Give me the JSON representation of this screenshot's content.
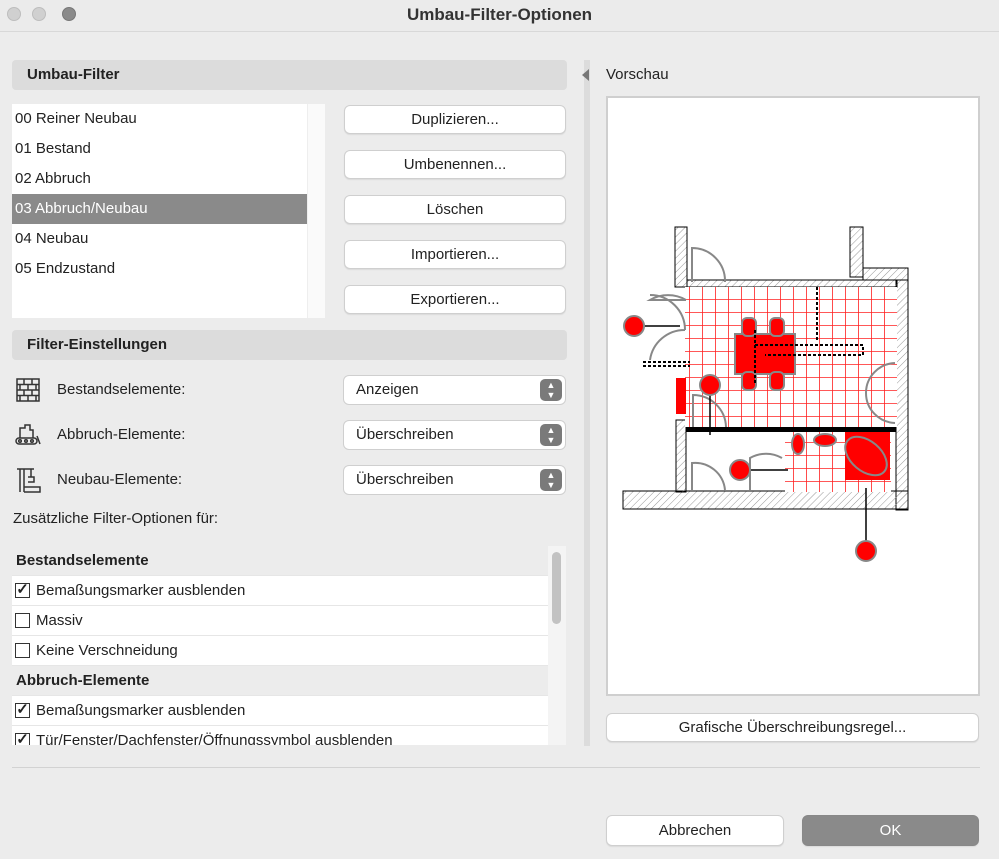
{
  "window": {
    "title": "Umbau-Filter-Optionen"
  },
  "filters": {
    "header": "Umbau-Filter",
    "items": [
      "00 Reiner Neubau",
      "01 Bestand",
      "02 Abbruch",
      "03 Abbruch/Neubau",
      "04 Neubau",
      "05 Endzustand"
    ],
    "selected_index": 3,
    "buttons": {
      "duplicate": "Duplizieren...",
      "rename": "Umbenennen...",
      "delete": "Löschen",
      "import": "Importieren...",
      "export": "Exportieren..."
    }
  },
  "settings": {
    "header": "Filter-Einstellungen",
    "rows": [
      {
        "label": "Bestandselemente:",
        "value": "Anzeigen",
        "icon": "brick-wall-icon"
      },
      {
        "label": "Abbruch-Elemente:",
        "value": "Überschreiben",
        "icon": "bulldozer-icon"
      },
      {
        "label": "Neubau-Elemente:",
        "value": "Überschreiben",
        "icon": "crane-icon"
      }
    ],
    "extra_label": "Zusätzliche Filter-Optionen für:"
  },
  "options": {
    "groups": [
      {
        "title": "Bestandselemente",
        "items": [
          {
            "label": "Bemaßungsmarker ausblenden",
            "checked": true
          },
          {
            "label": "Massiv",
            "checked": false
          },
          {
            "label": "Keine Verschneidung",
            "checked": false
          }
        ]
      },
      {
        "title": "Abbruch-Elemente",
        "items": [
          {
            "label": "Bemaßungsmarker ausblenden",
            "checked": true
          },
          {
            "label": "Tür/Fenster/Dachfenster/Öffnungssymbol ausblenden",
            "checked": true
          }
        ]
      }
    ]
  },
  "preview": {
    "label": "Vorschau",
    "override_button": "Grafische Überschreibungsregel...",
    "accent": "#ff0000"
  },
  "footer": {
    "cancel": "Abbrechen",
    "ok": "OK"
  }
}
